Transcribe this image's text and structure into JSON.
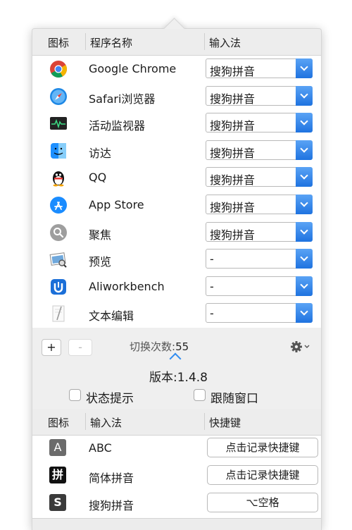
{
  "apps_table": {
    "headers": [
      "图标",
      "程序名称",
      "输入法"
    ],
    "rows": [
      {
        "icon": "chrome-icon",
        "name": "Google Chrome",
        "ime": "搜狗拼音"
      },
      {
        "icon": "safari-icon",
        "name": "Safari浏览器",
        "ime": "搜狗拼音"
      },
      {
        "icon": "activity-monitor-icon",
        "name": "活动监视器",
        "ime": "搜狗拼音"
      },
      {
        "icon": "finder-icon",
        "name": "访达",
        "ime": "搜狗拼音"
      },
      {
        "icon": "qq-penguin-icon",
        "name": "QQ",
        "ime": "搜狗拼音"
      },
      {
        "icon": "app-store-icon",
        "name": "App Store",
        "ime": "搜狗拼音"
      },
      {
        "icon": "spotlight-icon",
        "name": "聚焦",
        "ime": "搜狗拼音"
      },
      {
        "icon": "preview-icon",
        "name": "预览",
        "ime": "-"
      },
      {
        "icon": "aliworkbench-icon",
        "name": "Aliworkbench",
        "ime": "-"
      },
      {
        "icon": "textedit-icon",
        "name": "文本编辑",
        "ime": "-"
      }
    ]
  },
  "controls": {
    "add_label": "+",
    "remove_label": "-",
    "switch_count_label": "切换次数:",
    "switch_count": "55",
    "version": "版本:1.4.8",
    "status_hint_label": "状态提示",
    "follow_window_label": "跟随窗口"
  },
  "ime_table": {
    "headers": [
      "图标",
      "输入法",
      "快捷键"
    ],
    "rows": [
      {
        "icon_text": "A",
        "icon_color": "#6b6b6b",
        "name": "ABC",
        "shortcut": "点击记录快捷键"
      },
      {
        "icon_text": "拼",
        "icon_color": "#111111",
        "name": "简体拼音",
        "shortcut": "点击记录快捷键"
      },
      {
        "icon_text": "S",
        "icon_color": "#3a3a3a",
        "name": "搜狗拼音",
        "shortcut": "⌥空格"
      }
    ]
  },
  "colors": {
    "accent": "#2f8cf0",
    "popover_bg": "#efefef"
  }
}
